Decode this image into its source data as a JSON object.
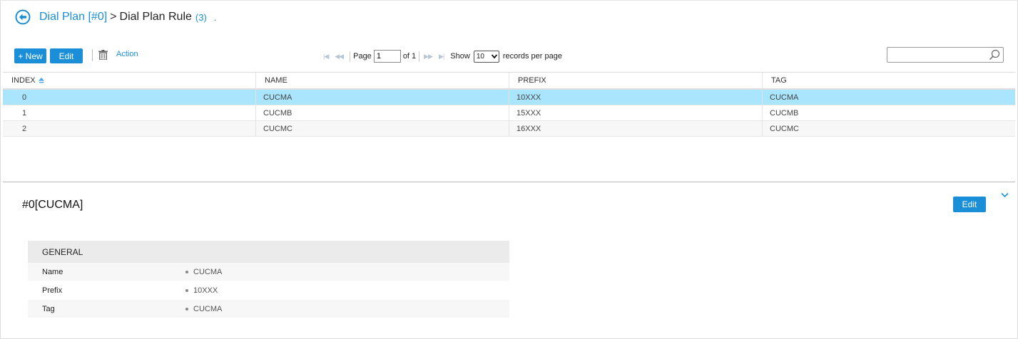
{
  "breadcrumb": {
    "parent": "Dial Plan [#0]",
    "separator": ">",
    "current": "Dial Plan Rule",
    "count": "(3)",
    "trailing": "."
  },
  "toolbar": {
    "new_label": "+ New",
    "edit_label": "Edit",
    "action_label": "Action"
  },
  "pager": {
    "page_label": "Page",
    "page_value": "1",
    "of_label": "of 1",
    "show_label": "Show",
    "per_page_value": "10",
    "records_label": "records per page"
  },
  "search": {
    "value": "",
    "placeholder": ""
  },
  "table": {
    "columns": [
      "INDEX",
      "NAME",
      "PREFIX",
      "TAG"
    ],
    "rows": [
      {
        "index": "0",
        "name": "CUCMA",
        "prefix": "10XXX",
        "tag": "CUCMA"
      },
      {
        "index": "1",
        "name": "CUCMB",
        "prefix": "15XXX",
        "tag": "CUCMB"
      },
      {
        "index": "2",
        "name": "CUCMC",
        "prefix": "16XXX",
        "tag": "CUCMC"
      }
    ],
    "selected_row": 0
  },
  "detail": {
    "title": "#0[CUCMA]",
    "edit_label": "Edit",
    "section_title": "GENERAL",
    "fields": [
      {
        "label": "Name",
        "value": "CUCMA"
      },
      {
        "label": "Prefix",
        "value": "10XXX"
      },
      {
        "label": "Tag",
        "value": "CUCMA"
      }
    ]
  },
  "colors": {
    "accent": "#1a8fd8",
    "selected_row": "#a9e5fd",
    "section_header": "#ebebeb"
  },
  "icons": {
    "back": "back-arrow-circle-icon",
    "trash": "trash-icon",
    "search": "search-icon",
    "sort": "sort-asc-icon",
    "collapse": "chevron-down-icon"
  }
}
